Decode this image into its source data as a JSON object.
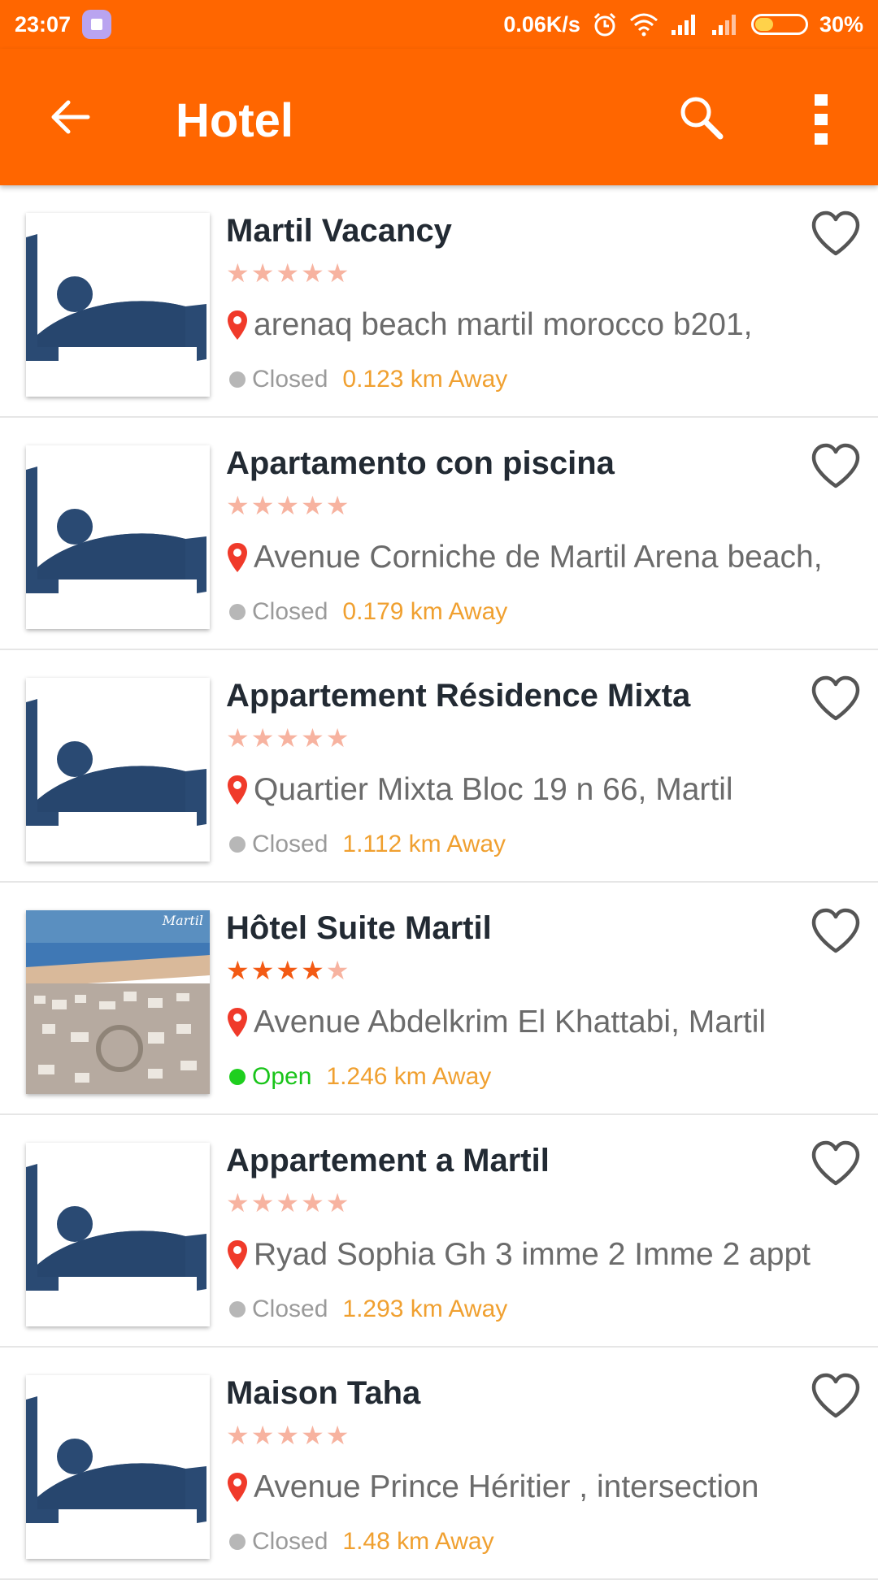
{
  "status_bar": {
    "time": "23:07",
    "network_speed": "0.06K/s",
    "battery": "30%",
    "icons": [
      "app-notification-icon",
      "alarm-icon",
      "wifi-icon",
      "signal-icon",
      "signal-icon",
      "battery-icon"
    ]
  },
  "app_bar": {
    "title": "Hotel",
    "back_icon": "arrow-left-icon",
    "search_icon": "search-icon",
    "more_icon": "more-vertical-icon"
  },
  "colors": {
    "accent": "#ff6600",
    "star_on": "#f35a14",
    "star_off": "#f7b3a0",
    "distance": "#f0a030",
    "open": "#19c41a",
    "closed": "#9a9a9a",
    "bed_icon": "#2a4a73"
  },
  "hotels": [
    {
      "name": "Martil Vacancy",
      "rating": 0,
      "address": "arenaq beach martil morocco b201,",
      "status": "Closed",
      "distance": "0.123 km Away",
      "image": "bed-icon"
    },
    {
      "name": "Apartamento con piscina",
      "rating": 0,
      "address": "Avenue Corniche de Martil Arena beach,",
      "status": "Closed",
      "distance": "0.179 km Away",
      "image": "bed-icon"
    },
    {
      "name": "Appartement Résidence Mixta",
      "rating": 0,
      "address": "Quartier Mixta Bloc 19 n 66, Martil",
      "status": "Closed",
      "distance": "1.112 km Away",
      "image": "bed-icon"
    },
    {
      "name": "Hôtel Suite Martil",
      "rating": 4,
      "address": "Avenue Abdelkrim El Khattabi, Martil",
      "status": "Open",
      "distance": "1.246 km Away",
      "image": "photo",
      "image_caption": "Martil"
    },
    {
      "name": "Appartement a Martil",
      "rating": 0,
      "address": "Ryad Sophia Gh 3 imme 2 Imme 2 appt",
      "status": "Closed",
      "distance": "1.293 km Away",
      "image": "bed-icon"
    },
    {
      "name": "Maison Taha",
      "rating": 0,
      "address": "Avenue Prince Héritier , intersection",
      "status": "Closed",
      "distance": "1.48 km Away",
      "image": "bed-icon"
    }
  ]
}
